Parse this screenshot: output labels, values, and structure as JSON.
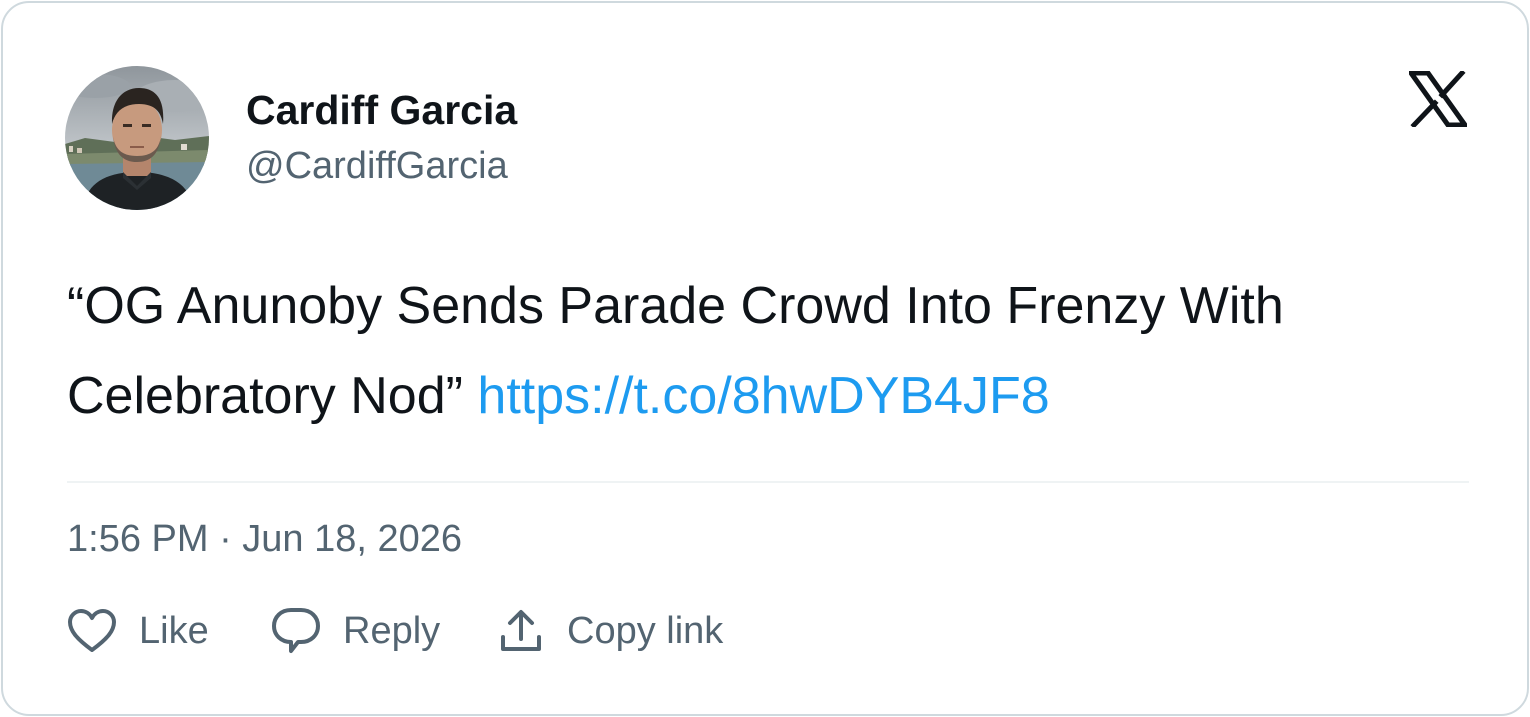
{
  "author": {
    "name": "Cardiff Garcia",
    "handle": "@CardiffGarcia"
  },
  "logo_icon": "x-logo-icon",
  "tweet": {
    "text": "“OG Anunoby Sends Parade Crowd Into Frenzy With Celebratory Nod”",
    "link": "https://t.co/8hwDYB4JF8"
  },
  "timestamp": "1:56 PM · Jun 18, 2026",
  "actions": {
    "like_label": "Like",
    "reply_label": "Reply",
    "copy_label": "Copy link"
  },
  "colors": {
    "text": "#0f1419",
    "secondary": "#536471",
    "link": "#1d9bf0",
    "border": "#cfd9de"
  }
}
